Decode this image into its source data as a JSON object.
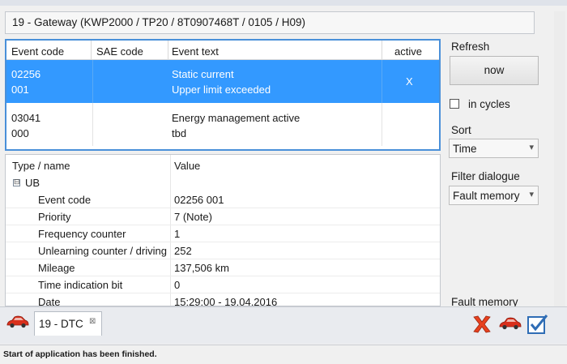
{
  "header": {
    "title": "19 - Gateway  (KWP2000 / TP20 / 8T0907468T  / 0105 / H09)"
  },
  "events": {
    "columns": [
      "Event code",
      "SAE code",
      "Event text",
      "active"
    ],
    "rows": [
      {
        "code1": "02256",
        "code2": "001",
        "sae": "",
        "text1": "Static current",
        "text2": "Upper limit exceeded",
        "active": "X",
        "selected": true
      },
      {
        "code1": "03041",
        "code2": "000",
        "sae": "",
        "text1": "Energy management active",
        "text2": "tbd",
        "active": "",
        "selected": false
      }
    ]
  },
  "details": {
    "columns": [
      "Type / name",
      "Value"
    ],
    "group": {
      "label": "UB",
      "expander": "⊟"
    },
    "rows": [
      {
        "name": "Event code",
        "value": "02256 001"
      },
      {
        "name": "Priority",
        "value": "7  (Note)"
      },
      {
        "name": "Frequency counter",
        "value": "1"
      },
      {
        "name": "Unlearning counter / driving",
        "value": "252"
      },
      {
        "name": "Mileage",
        "value": "137,506 km"
      },
      {
        "name": "Time indication bit",
        "value": "0"
      },
      {
        "name": "Date",
        "value": "15:29:00 - 19.04.2016"
      }
    ]
  },
  "right_panel": {
    "refresh_label": "Refresh",
    "now_button": "now",
    "in_cycles_label": "in cycles",
    "in_cycles_checked": false,
    "sort_label": "Sort",
    "sort_value": "Time",
    "filter_label": "Filter dialogue",
    "filter_value": "Fault memory",
    "fault_memory_label": "Fault memory"
  },
  "tabs": [
    {
      "label": "19 - DTC",
      "close": "⊠",
      "active": true
    }
  ],
  "icons": {
    "car": "car-icon",
    "delete": "red-x-icon",
    "checklist": "checklist-icon",
    "chevron": "▾"
  },
  "colors": {
    "selection": "#3399ff",
    "table_border": "#4a90d9",
    "delete": "#e8411f",
    "car": "#d9301c"
  },
  "status": {
    "text": "Start of application has been finished."
  }
}
